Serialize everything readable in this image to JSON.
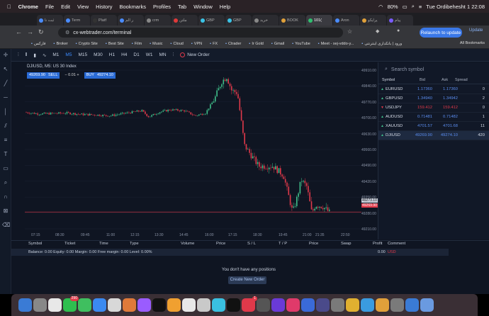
{
  "menubar": {
    "items": [
      "Chrome",
      "File",
      "Edit",
      "View",
      "History",
      "Bookmarks",
      "Profiles",
      "Tab",
      "Window",
      "Help"
    ],
    "battery": "80%",
    "datetime": "Tue Ordibehesht 1  22:08"
  },
  "tabs": [
    {
      "label": "ثبت نا"
    },
    {
      "label": "Term"
    },
    {
      "label": "Platf"
    },
    {
      "label": "ر الم"
    },
    {
      "label": "crm"
    },
    {
      "label": "ملتن"
    },
    {
      "label": "GBP"
    },
    {
      "label": "GBP"
    },
    {
      "label": "خرید"
    },
    {
      "label": "BOOK"
    },
    {
      "label": "101("
    },
    {
      "label": "Aron"
    },
    {
      "label": "پرایکو"
    },
    {
      "label": "پیام"
    }
  ],
  "address_bar": {
    "url": "cx-webtrader.com/terminal",
    "relaunch_label": "Relaunch to update",
    "update_label": "Update"
  },
  "bookmarks": {
    "items": [
      "فارکس",
      "Broker",
      "Crypto Site",
      "Best Site",
      "Film",
      "Music",
      "Cloud",
      "VPN",
      "FX",
      "Ctrader",
      "Ir Gold",
      "Gmail",
      "YouTube",
      "Meet - sej-vddo-y...",
      "ورود | بانکداری اینترنتی"
    ],
    "all_label": "All Bookmarks"
  },
  "toolbar": {
    "timeframes": [
      "M1",
      "M5",
      "M15",
      "M30",
      "H1",
      "H4",
      "D1",
      "W1",
      "MN"
    ],
    "active_timeframe": "M5",
    "new_order": "New Order"
  },
  "chart": {
    "symbol_label": "DJIUSD, M5:  US 30 Index",
    "sell_price": "49269.90",
    "sell_label": "SELL",
    "lot": "0.01",
    "buy_label": "BUY",
    "buy_price": "49274.10",
    "ask_marker": "49273.10",
    "bid_marker": "49269.90",
    "y_ticks": [
      "49910.00",
      "49840.00",
      "49770.00",
      "49700.00",
      "49630.00",
      "49560.00",
      "49490.00",
      "49420.00",
      "49350.00",
      "49280.00",
      "49210.00"
    ],
    "x_ticks": [
      "07:15",
      "08:30",
      "09:45",
      "11:00",
      "12:15",
      "13:30",
      "14:45",
      "16:00",
      "17:15",
      "18:30",
      "19:45",
      "21:00",
      "21:35",
      "22:50"
    ],
    "colors": {
      "up": "#3fbf8a",
      "down": "#e0394a",
      "bg": "#0f1522"
    }
  },
  "market_watch": {
    "search_placeholder": "Search symbol",
    "headers": {
      "symbol": "Symbol",
      "bid": "Bid",
      "ask": "Ask",
      "spread": "Spread"
    },
    "rows": [
      {
        "symbol": "EURUSD",
        "bid": "1.17360",
        "ask": "1.17360",
        "spread": "0",
        "dir": "up"
      },
      {
        "symbol": "GBPUSD",
        "bid": "1.34940",
        "ask": "1.34942",
        "spread": "2",
        "dir": "up"
      },
      {
        "symbol": "USDJPY",
        "bid": "159.412",
        "ask": "159.412",
        "spread": "0",
        "dir": "down"
      },
      {
        "symbol": "AUDUSD",
        "bid": "0.71481",
        "ask": "0.71482",
        "spread": "1",
        "dir": "up"
      },
      {
        "symbol": "XAUUSD",
        "bid": "4701.57",
        "ask": "4701.68",
        "spread": "11",
        "dir": "up"
      },
      {
        "symbol": "DJIUSD",
        "bid": "49269.90",
        "ask": "49274.10",
        "spread": "420",
        "dir": "up"
      }
    ]
  },
  "positions": {
    "headers": [
      "Symbol",
      "Ticket",
      "Time",
      "Type",
      "Volume",
      "Price",
      "S / L",
      "T / P",
      "Price",
      "Swap",
      "Profit",
      "Comment"
    ],
    "balance_line": "Balance: 0.00   Equity: 0.00   Margin: 0.00   Free margin: 0.00   Level: 0.00%",
    "total": "0.00",
    "currency": "USD",
    "empty_message": "You don't have any positions",
    "create_label": "Create New Order"
  },
  "dock": {
    "badges": [
      "290",
      "1"
    ]
  }
}
